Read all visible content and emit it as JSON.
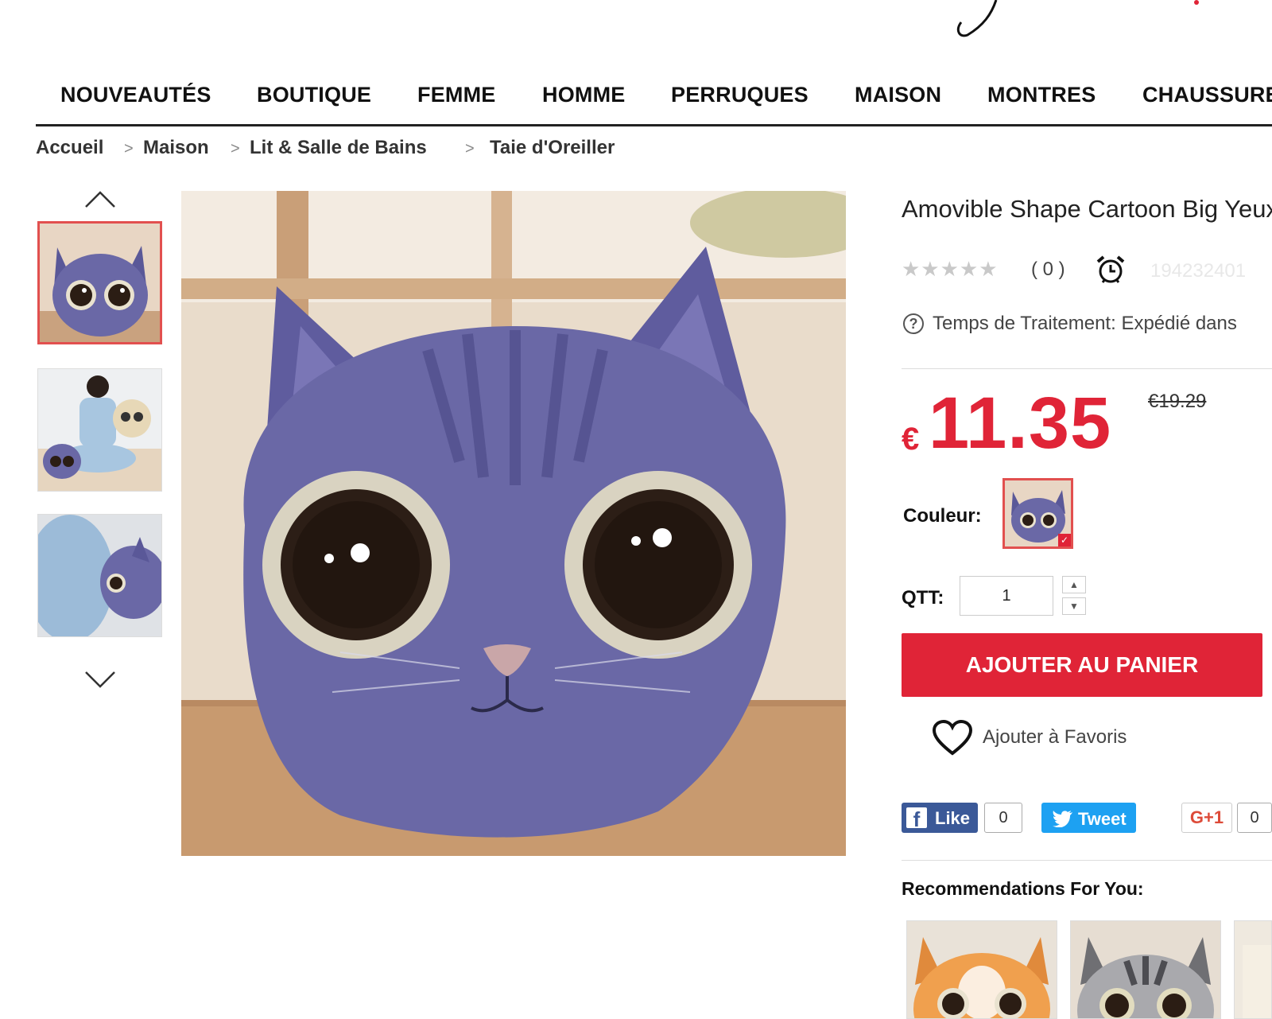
{
  "nav": {
    "items": [
      "NOUVEAUTÉS",
      "BOUTIQUE",
      "FEMME",
      "HOMME",
      "PERRUQUES",
      "MAISON",
      "MONTRES",
      "CHAUSSURES"
    ]
  },
  "breadcrumb": {
    "items": [
      "Accueil",
      "Maison",
      "Lit & Salle de Bains",
      "Taie d'Oreiller"
    ],
    "separator": ">"
  },
  "gallery": {
    "thumbnails": [
      "cat-pillow-front",
      "girl-with-cat-pillows",
      "cat-pillow-side"
    ],
    "selected_index": 0,
    "up_icon": "chevron-up-icon",
    "down_icon": "chevron-down-icon"
  },
  "product": {
    "title": "Amovible Shape Cartoon Big Yeux",
    "rating": 0,
    "review_count": "( 0 )",
    "sku": "194232401",
    "processing_label": "Temps de Traitement:",
    "processing_value": "Expédié dans",
    "currency": "€",
    "price": "11.35",
    "old_price": "€19.29",
    "color_label": "Couleur:",
    "qty_label": "QTT:",
    "qty_value": "1",
    "add_to_cart": "AJOUTER AU PANIER",
    "add_to_favorites": "Ajouter à Favoris"
  },
  "social": {
    "facebook_label": "Like",
    "facebook_count": "0",
    "twitter_label": "Tweet",
    "gplus_label": "G+1",
    "gplus_count": "0"
  },
  "recommendations": {
    "title": "Recommendations For You:",
    "items": [
      "orange-cat-pillow",
      "grey-tabby-cat-pillow",
      "cream-cat-pillow"
    ]
  },
  "colors": {
    "accent": "#e02437",
    "facebook": "#3b5998",
    "twitter": "#1da1f2",
    "gplus": "#dd4b39",
    "cat_purple": "#6a68a6"
  }
}
